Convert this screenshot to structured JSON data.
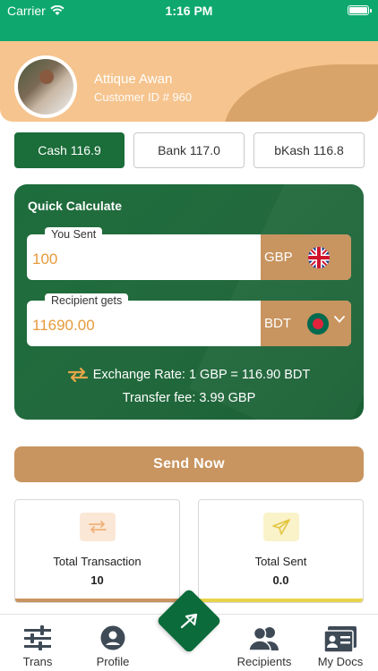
{
  "status_bar": {
    "carrier": "Carrier",
    "time": "1:16 PM"
  },
  "profile": {
    "name": "Attique Awan",
    "customer_id": "Customer ID # 960"
  },
  "rate_tabs": [
    {
      "label": "Cash 116.9",
      "active": true
    },
    {
      "label": "Bank 117.0",
      "active": false
    },
    {
      "label": "bKash 116.8",
      "active": false
    }
  ],
  "calculator": {
    "title": "Quick Calculate",
    "you_sent": {
      "label": "You Sent",
      "value": "100",
      "currency": "GBP",
      "flag": "uk-flag-icon"
    },
    "recipient_gets": {
      "label": "Recipient gets",
      "value": "11690.00",
      "currency": "BDT",
      "flag": "bangladesh-flag-icon"
    },
    "exchange_rate": "Exchange Rate: 1 GBP = 116.90 BDT",
    "transfer_fee": "Transfer fee: 3.99 GBP"
  },
  "send_button": "Send Now",
  "stats": [
    {
      "title": "Total Transaction",
      "value": "10",
      "icon": "exchange-arrows-icon",
      "color": "#c8945f"
    },
    {
      "title": "Total Sent",
      "value": "0.0",
      "icon": "paper-plane-icon",
      "color": "#e8d44a"
    }
  ],
  "nav": [
    {
      "label": "Trans",
      "icon": "sliders-icon"
    },
    {
      "label": "Profile",
      "icon": "user-circle-icon"
    },
    {
      "label": "Recipients",
      "icon": "people-icon"
    },
    {
      "label": "My Docs",
      "icon": "id-card-icon"
    }
  ],
  "colors": {
    "primary_green": "#1b6d39",
    "accent_tan": "#c8945f",
    "header_peach": "#f6c48e",
    "status_green": "#0ea86f"
  }
}
